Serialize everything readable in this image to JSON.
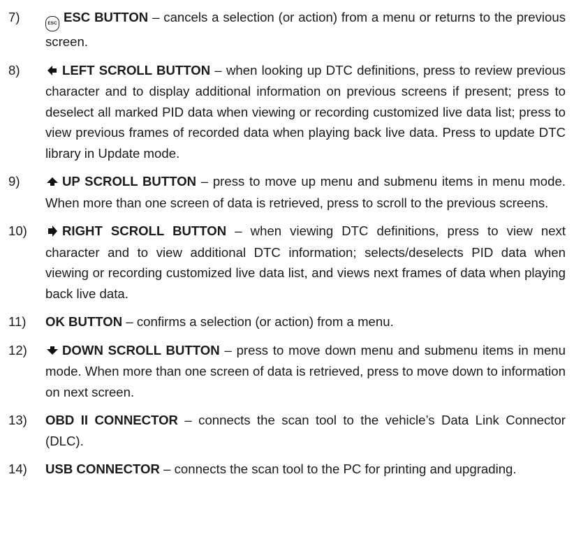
{
  "items": [
    {
      "number": "7)",
      "icon": "esc-icon",
      "icon_text": "ESC",
      "title": "ESC BUTTON",
      "desc": " – cancels a selection (or action) from a menu or returns to the previous screen."
    },
    {
      "number": "8)",
      "icon": "left-arrow-icon",
      "icon_glyph": "◆",
      "title": "LEFT SCROLL BUTTON",
      "desc": " – when looking up DTC definitions, press to review previous character and to display additional information on previous screens if present; press to deselect all marked PID data when viewing or recording customized live data list; press to view previous frames of recorded data when playing back live data. Press to update DTC library in Update mode."
    },
    {
      "number": "9)",
      "icon": "up-arrow-icon",
      "icon_glyph": "▲",
      "title": "UP SCROLL BUTTON",
      "desc": " – press to move up menu and submenu items in menu mode. When more than one screen of data is retrieved, press to scroll to the previous screens."
    },
    {
      "number": "10)",
      "icon": "right-arrow-icon",
      "icon_glyph": "➧",
      "title": "RIGHT SCROLL BUTTON",
      "desc": " – when viewing DTC definitions, press to view next character and to view additional DTC information; selects/deselects PID data when viewing or recording customized live data list, and views next frames of data when playing back live data."
    },
    {
      "number": "11)",
      "title": "OK BUTTON",
      "desc": " – confirms a selection (or action) from a menu."
    },
    {
      "number": "12)",
      "icon": "down-arrow-icon",
      "icon_glyph": "▼",
      "title": "DOWN SCROLL BUTTON",
      "desc": " – press to move down menu and submenu items in menu mode. When more than one screen of data is retrieved, press to move down to information on next screen."
    },
    {
      "number": "13)",
      "title": "OBD II CONNECTOR",
      "desc": " – connects the scan tool to the vehicle’s Data Link Connector (DLC)."
    },
    {
      "number": "14)",
      "title": "USB CONNECTOR",
      "desc": " – connects the scan tool to the PC for printing and upgrading."
    }
  ]
}
